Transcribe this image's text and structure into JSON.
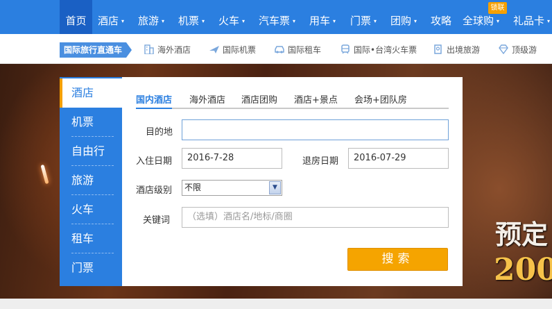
{
  "topnav": {
    "items": [
      {
        "label": "首页",
        "has_arrow": false
      },
      {
        "label": "酒店",
        "has_arrow": true
      },
      {
        "label": "旅游",
        "has_arrow": true
      },
      {
        "label": "机票",
        "has_arrow": true
      },
      {
        "label": "火车",
        "has_arrow": true
      },
      {
        "label": "汽车票",
        "has_arrow": true
      },
      {
        "label": "用车",
        "has_arrow": true
      },
      {
        "label": "门票",
        "has_arrow": true
      },
      {
        "label": "团购",
        "has_arrow": true
      },
      {
        "label": "攻略",
        "has_arrow": false
      },
      {
        "label": "全球购",
        "has_arrow": true
      },
      {
        "label": "礼品卡",
        "has_arrow": true
      }
    ],
    "badge": "锁联",
    "arrow_glyph": "▾"
  },
  "subnav": {
    "tag": "国际旅行直通车",
    "links": [
      {
        "label": "海外酒店",
        "icon": "building-icon"
      },
      {
        "label": "国际机票",
        "icon": "plane-icon"
      },
      {
        "label": "国际租车",
        "icon": "car-icon"
      },
      {
        "label": "国际•台湾火车票",
        "icon": "train-icon"
      },
      {
        "label": "出境旅游",
        "icon": "passport-icon"
      },
      {
        "label": "顶级游",
        "icon": "diamond-icon"
      }
    ]
  },
  "side": {
    "items": [
      "酒店",
      "机票",
      "自由行",
      "旅游",
      "火车",
      "租车",
      "门票"
    ],
    "active_index": 0
  },
  "search": {
    "tabs": [
      "国内酒店",
      "海外酒店",
      "酒店团购",
      "酒店+景点",
      "会场+团队房"
    ],
    "active_tab": 0,
    "destination_label": "目的地",
    "destination_value": "",
    "checkin_label": "入住日期",
    "checkin_value": "2016-7-28",
    "checkout_label": "退房日期",
    "checkout_value": "2016-07-29",
    "level_label": "酒店级别",
    "level_value": "不限",
    "keyword_label": "关键词",
    "keyword_placeholder": "（选填）酒店名/地标/商圈",
    "search_button": "搜索"
  },
  "banner": {
    "promo_line1": "预定",
    "promo_line2": "200"
  },
  "colors": {
    "brand_blue": "#2b7fe0",
    "accent_orange": "#f5a400"
  }
}
